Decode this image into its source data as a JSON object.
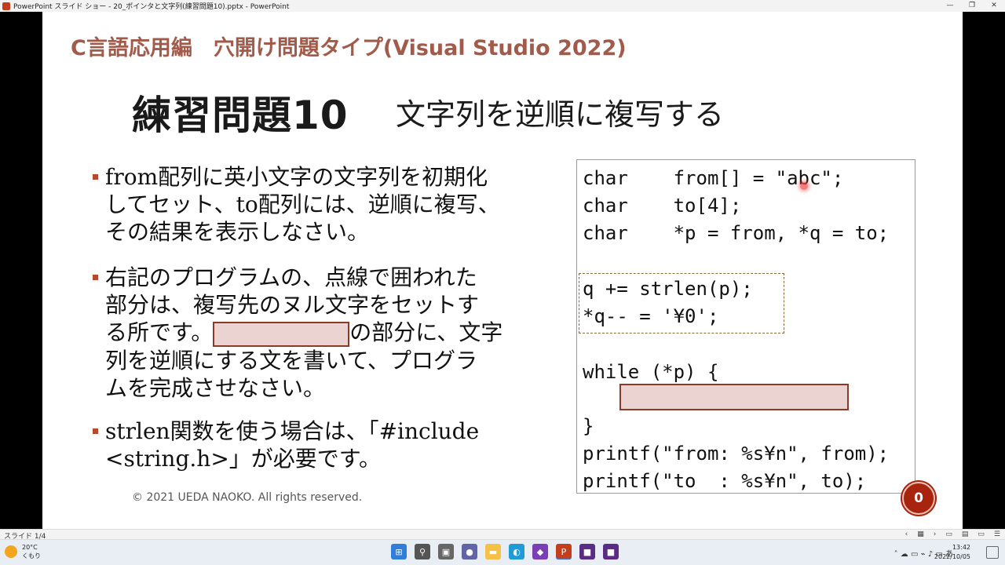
{
  "window": {
    "title": "PowerPoint スライド ショー - 20_ポインタと文字列(練習問題10).pptx - PowerPoint",
    "minimize": "—",
    "restore": "❐",
    "close": "✕"
  },
  "slide": {
    "header": "C言語応用編　穴開け問題タイプ(Visual Studio 2022)",
    "title": "練習問題10",
    "subtitle": "文字列を逆順に複写する",
    "bullets": [
      {
        "lines": [
          "from配列に英小文字の文字列を初期化",
          "してセット、to配列には、逆順に複写、",
          "その結果を表示しなさい。"
        ]
      },
      {
        "lines": [
          "右記のプログラムの、点線で囲われた",
          "部分は、複写先のヌル文字をセットす"
        ],
        "line3_prefix": "る所です。",
        "line3_suffix": "の部分に、文字",
        "lines_after": [
          "列を逆順にする文を書いて、プログラ",
          "ムを完成させなさい。"
        ]
      },
      {
        "lines": [
          "strlen関数を使う場合は、「#include",
          "<string.h>」が必要です。"
        ]
      }
    ],
    "copyright": "© 2021 UEDA NAOKO. All rights reserved.",
    "code_lines": [
      "char    from[] = \"abc\";",
      "char    to[4];",
      "char    *p = from, *q = to;",
      "q += strlen(p);",
      "*q-- = '¥0';",
      "while (*p) {",
      "}",
      "printf(\"from: %s¥n\", from);",
      "printf(\"to  : %s¥n\", to);"
    ],
    "slide_badge": "0"
  },
  "statusbar": {
    "slide_counter": "スライド 1/4",
    "controls": [
      "‹",
      "▦",
      "›",
      "▭",
      "▤",
      "▭",
      "☰"
    ]
  },
  "taskbar": {
    "weather_temp": "20°C",
    "weather_desc": "くもり",
    "tray_icons": "˄ ☁ ▭ ⌁ ♪ ▭ あ",
    "time": "13:42",
    "date": "2022/10/05",
    "app_icons": [
      {
        "name": "start-icon",
        "color": "#2f7fd8",
        "glyph": "⊞"
      },
      {
        "name": "search-icon",
        "color": "#555555",
        "glyph": "⚲"
      },
      {
        "name": "task-view-icon",
        "color": "#666666",
        "glyph": "▣"
      },
      {
        "name": "chat-icon",
        "color": "#6264a7",
        "glyph": "●"
      },
      {
        "name": "file-explorer-icon",
        "color": "#f5c146",
        "glyph": "▬"
      },
      {
        "name": "edge-icon",
        "color": "#1f9bd6",
        "glyph": "◐"
      },
      {
        "name": "visual-studio-icon",
        "color": "#7a3fb5",
        "glyph": "◆"
      },
      {
        "name": "powerpoint-icon",
        "color": "#c43e1c",
        "glyph": "P"
      },
      {
        "name": "app-icon-purple-1",
        "color": "#5b2c86",
        "glyph": "■"
      },
      {
        "name": "app-icon-purple-2",
        "color": "#5b2c86",
        "glyph": "■"
      }
    ]
  },
  "colors": {
    "accent_red": "#a8240f",
    "header_brown": "#a25b4a",
    "blank_fill": "#ead3d0"
  }
}
